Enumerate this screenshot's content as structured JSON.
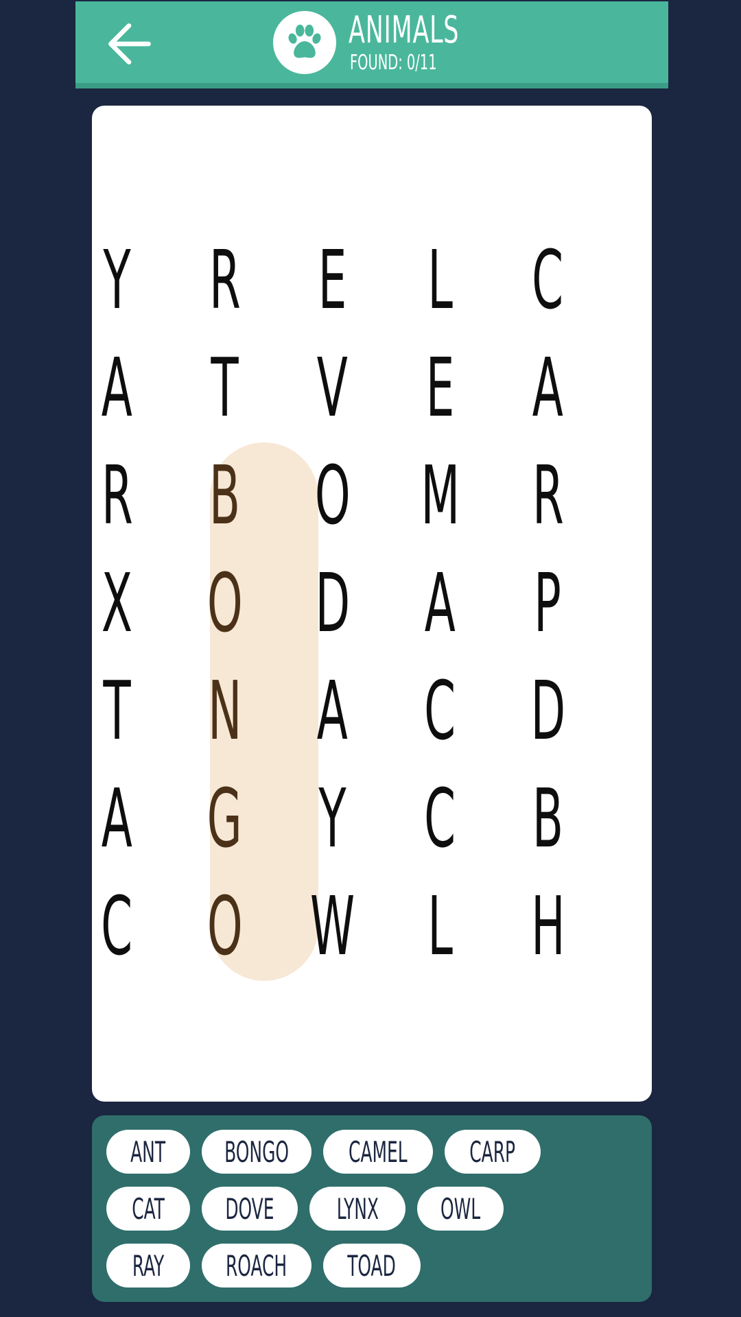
{
  "header": {
    "title": "ANIMALS",
    "found_text": "FOUND: 0/11",
    "back_icon": "arrow-left-icon",
    "category_icon": "paw-icon",
    "color": "#4ab79c",
    "accent": "#3a9c86"
  },
  "grid": {
    "rows": [
      [
        "Y",
        "R",
        "E",
        "L",
        "C"
      ],
      [
        "A",
        "T",
        "V",
        "E",
        "A"
      ],
      [
        "R",
        "B",
        "O",
        "M",
        "R"
      ],
      [
        "X",
        "O",
        "D",
        "A",
        "P"
      ],
      [
        "T",
        "N",
        "A",
        "C",
        "D"
      ],
      [
        "A",
        "G",
        "Y",
        "C",
        "B"
      ],
      [
        "C",
        "O",
        "W",
        "L",
        "H"
      ]
    ],
    "highlight": {
      "word": "BONGO",
      "start": [
        2,
        1
      ],
      "end": [
        6,
        1
      ],
      "color": "#f7e7d5"
    }
  },
  "words": [
    [
      "ANT",
      "BONGO",
      "CAMEL",
      "CARP"
    ],
    [
      "CAT",
      "DOVE",
      "LYNX",
      "OWL"
    ],
    [
      "RAY",
      "ROACH",
      "TOAD"
    ]
  ],
  "colors": {
    "background": "#1b2640",
    "board": "#ffffff",
    "word_panel": "#2f6e6b",
    "chip_text": "#1b2640"
  }
}
